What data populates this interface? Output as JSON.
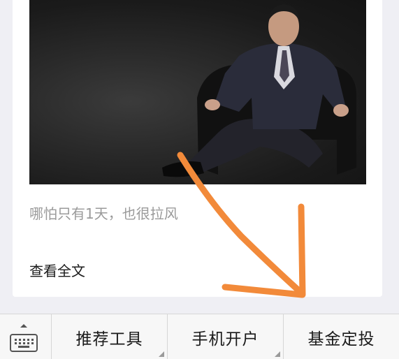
{
  "article_card": {
    "subtitle": "哪怕只有1天，也很拉风",
    "read_more": "查看全文"
  },
  "bottom_menu": {
    "keyboard_icon": "keyboard-icon",
    "items": [
      {
        "label": "推荐工具",
        "has_submenu": true
      },
      {
        "label": "手机开户",
        "has_submenu": true
      },
      {
        "label": "基金定投",
        "has_submenu": false
      }
    ]
  },
  "colors": {
    "annotation_arrow": "#f28a3a",
    "subtitle_text": "#9a9a9a",
    "background": "#efeff4"
  }
}
